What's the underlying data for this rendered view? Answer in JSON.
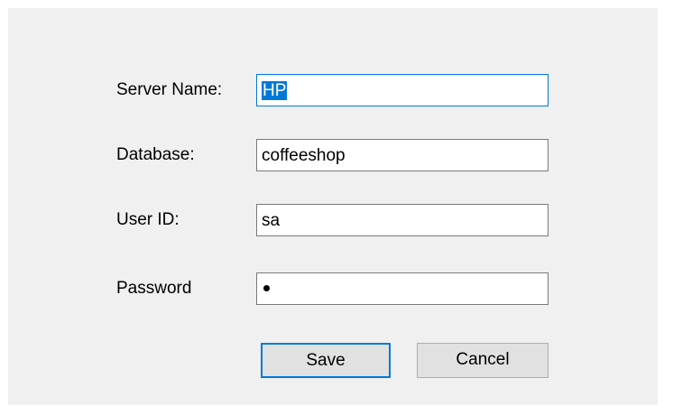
{
  "form": {
    "server_name": {
      "label": "Server Name:",
      "value": "HP"
    },
    "database": {
      "label": "Database:",
      "value": "coffeeshop"
    },
    "user_id": {
      "label": "User ID:",
      "value": "sa"
    },
    "password": {
      "label": "Password",
      "masked_length": 1
    }
  },
  "buttons": {
    "save_label": "Save",
    "cancel_label": "Cancel"
  },
  "colors": {
    "dialog_background": "#f0f0f0",
    "focus_accent": "#0078d7",
    "field_border": "#7a7a7a",
    "button_face": "#e1e1e1"
  }
}
